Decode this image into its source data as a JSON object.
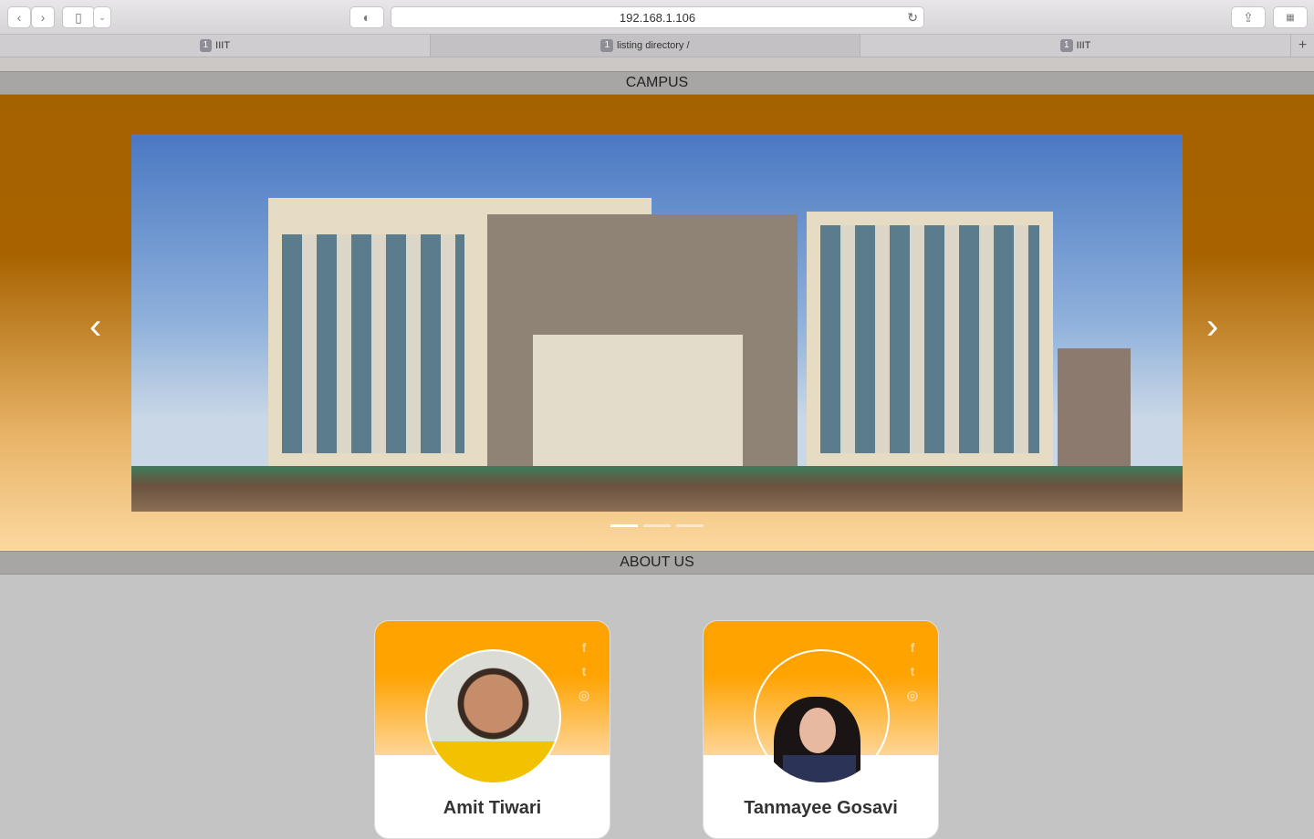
{
  "browser": {
    "url": "192.168.1.106",
    "tabs": [
      {
        "count": "1",
        "label": "IIIT"
      },
      {
        "count": "1",
        "label": "listing directory /"
      },
      {
        "count": "1",
        "label": "IIIT"
      }
    ],
    "new_tab": "+"
  },
  "sections": {
    "campus": "CAMPUS",
    "about": "ABOUT US"
  },
  "carousel": {
    "slide_count": 3,
    "active_slide": 1,
    "prev": "‹",
    "next": "›"
  },
  "team": [
    {
      "name": "Amit Tiwari",
      "socials": [
        "facebook-icon",
        "twitter-icon",
        "github-icon"
      ]
    },
    {
      "name": "Tanmayee Gosavi",
      "socials": [
        "facebook-icon",
        "twitter-icon",
        "github-icon"
      ]
    }
  ],
  "colors": {
    "accent": "#ffa300",
    "carousel_top": "#a56200"
  }
}
